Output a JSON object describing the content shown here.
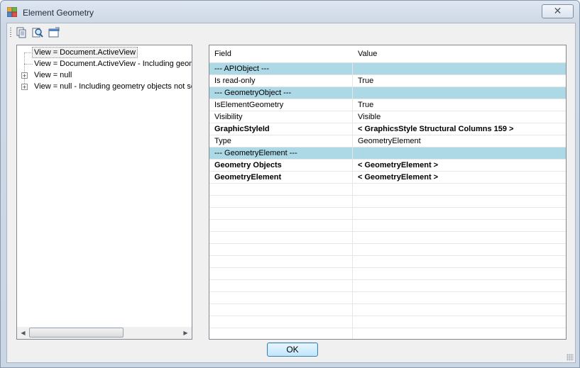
{
  "window": {
    "title": "Element Geometry",
    "close_glyph": "✕"
  },
  "toolbar": {
    "icons": [
      "copy-icon",
      "find-icon",
      "window-icon"
    ]
  },
  "tree": {
    "items": [
      {
        "label": "View = Document.ActiveView",
        "expandable": false,
        "selected": true
      },
      {
        "label": "View = Document.ActiveView - Including geom",
        "expandable": false,
        "selected": false
      },
      {
        "label": "View = null",
        "expandable": true,
        "selected": false
      },
      {
        "label": "View = null - Including geometry objects not set",
        "expandable": true,
        "selected": false
      }
    ]
  },
  "grid": {
    "columns": [
      "Field",
      "Value"
    ],
    "rows": [
      {
        "field": "--- APIObject ---",
        "value": "",
        "section": true,
        "bold": false
      },
      {
        "field": "Is read-only",
        "value": "True",
        "section": false,
        "bold": false
      },
      {
        "field": "--- GeometryObject ---",
        "value": "",
        "section": true,
        "bold": false
      },
      {
        "field": "IsElementGeometry",
        "value": "True",
        "section": false,
        "bold": false
      },
      {
        "field": "Visibility",
        "value": "Visible",
        "section": false,
        "bold": false
      },
      {
        "field": "GraphicStyleId",
        "value": "< GraphicsStyle  Structural Columns    159 >",
        "section": false,
        "bold": true
      },
      {
        "field": "Type",
        "value": "GeometryElement",
        "section": false,
        "bold": false
      },
      {
        "field": "--- GeometryElement ---",
        "value": "",
        "section": true,
        "bold": false
      },
      {
        "field": "Geometry Objects",
        "value": "< GeometryElement >",
        "section": false,
        "bold": true
      },
      {
        "field": "GeometryElement",
        "value": "< GeometryElement >",
        "section": false,
        "bold": true
      }
    ],
    "empty_rows": 13
  },
  "ok_label": "OK",
  "colors": {
    "section_bg": "#add8e6",
    "button_border": "#3c7fb1"
  }
}
